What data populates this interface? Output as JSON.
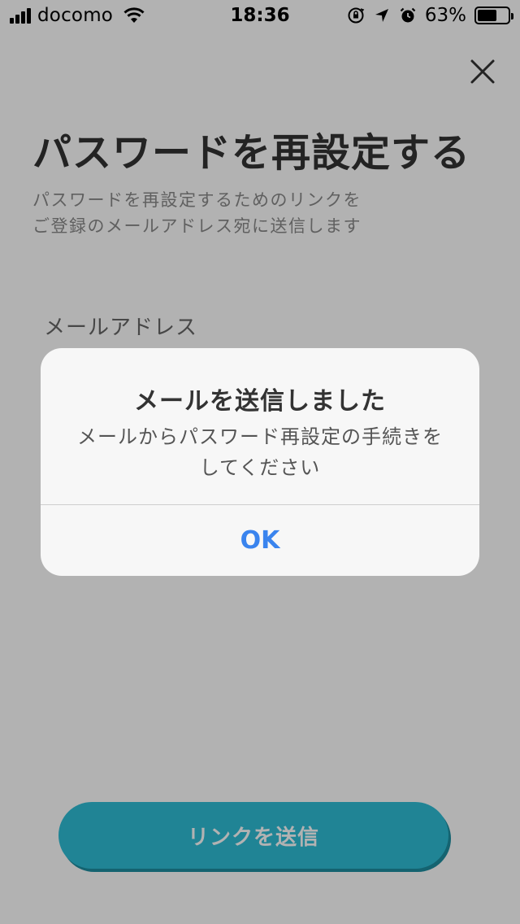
{
  "status_bar": {
    "carrier": "docomo",
    "time": "18:36",
    "battery_percent": "63%",
    "battery_level": 0.63,
    "icons": [
      "signal-icon",
      "wifi-icon",
      "orientation-lock-icon",
      "location-icon",
      "alarm-icon",
      "battery-icon"
    ]
  },
  "page": {
    "close_icon": "close-icon",
    "title": "パスワードを再設定する",
    "subtitle_lines": [
      "パスワードを再設定するためのリンクを",
      "ご登録のメールアドレス宛に送信します"
    ],
    "email_label": "メールアドレス",
    "email_value": "",
    "send_button_label": "リンクを送信",
    "send_button_color": "#2fbdd6"
  },
  "alert": {
    "title": "メールを送信しました",
    "message_lines": [
      "メールからパスワード再設定の手続きを",
      "してください"
    ],
    "ok_label": "OK",
    "ok_color": "#3a84ee"
  }
}
